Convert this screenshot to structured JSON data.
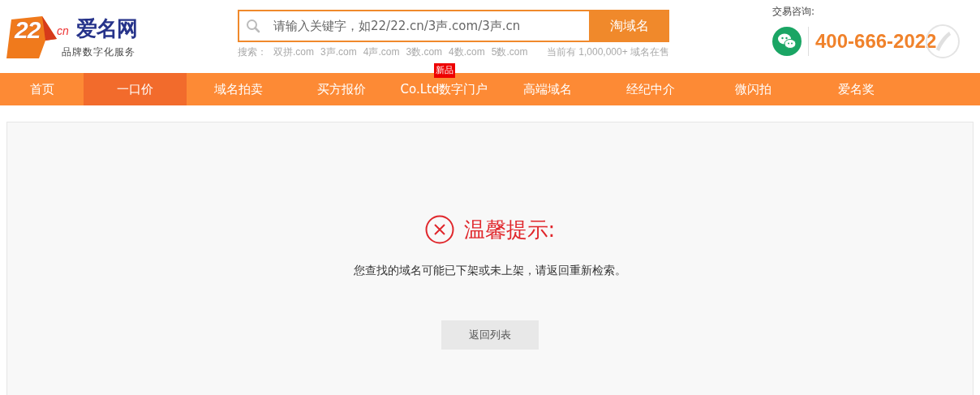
{
  "logo": {
    "digits": "22",
    "suffix": "cn",
    "name": "爱名网",
    "slogan": "品牌数字化服务"
  },
  "search": {
    "placeholder": "请输入关键字，如22/22.cn/3声.com/3声.cn",
    "button": "淘域名",
    "hint_label": "搜索：",
    "hints": [
      "双拼.com",
      "3声.com",
      "4声.com",
      "3数.com",
      "4数.com",
      "5数.com"
    ],
    "stats": "当前有 1,000,000+ 域名在售"
  },
  "contact": {
    "label": "交易咨询:",
    "phone": "400-666-2022"
  },
  "nav": [
    {
      "label": "首页",
      "selected": false
    },
    {
      "label": "一口价",
      "selected": true
    },
    {
      "label": "域名拍卖",
      "selected": false
    },
    {
      "label": "买方报价",
      "selected": false
    },
    {
      "label": "Co.Ltd数字门户",
      "selected": false,
      "badge": "新品"
    },
    {
      "label": "高端域名",
      "selected": false
    },
    {
      "label": "经纪中介",
      "selected": false
    },
    {
      "label": "微闪拍",
      "selected": false
    },
    {
      "label": "爱名奖",
      "selected": false
    }
  ],
  "notice": {
    "title": "温馨提示:",
    "message": "您查找的域名可能已下架或未上架，请返回重新检索。",
    "button": "返回列表"
  }
}
